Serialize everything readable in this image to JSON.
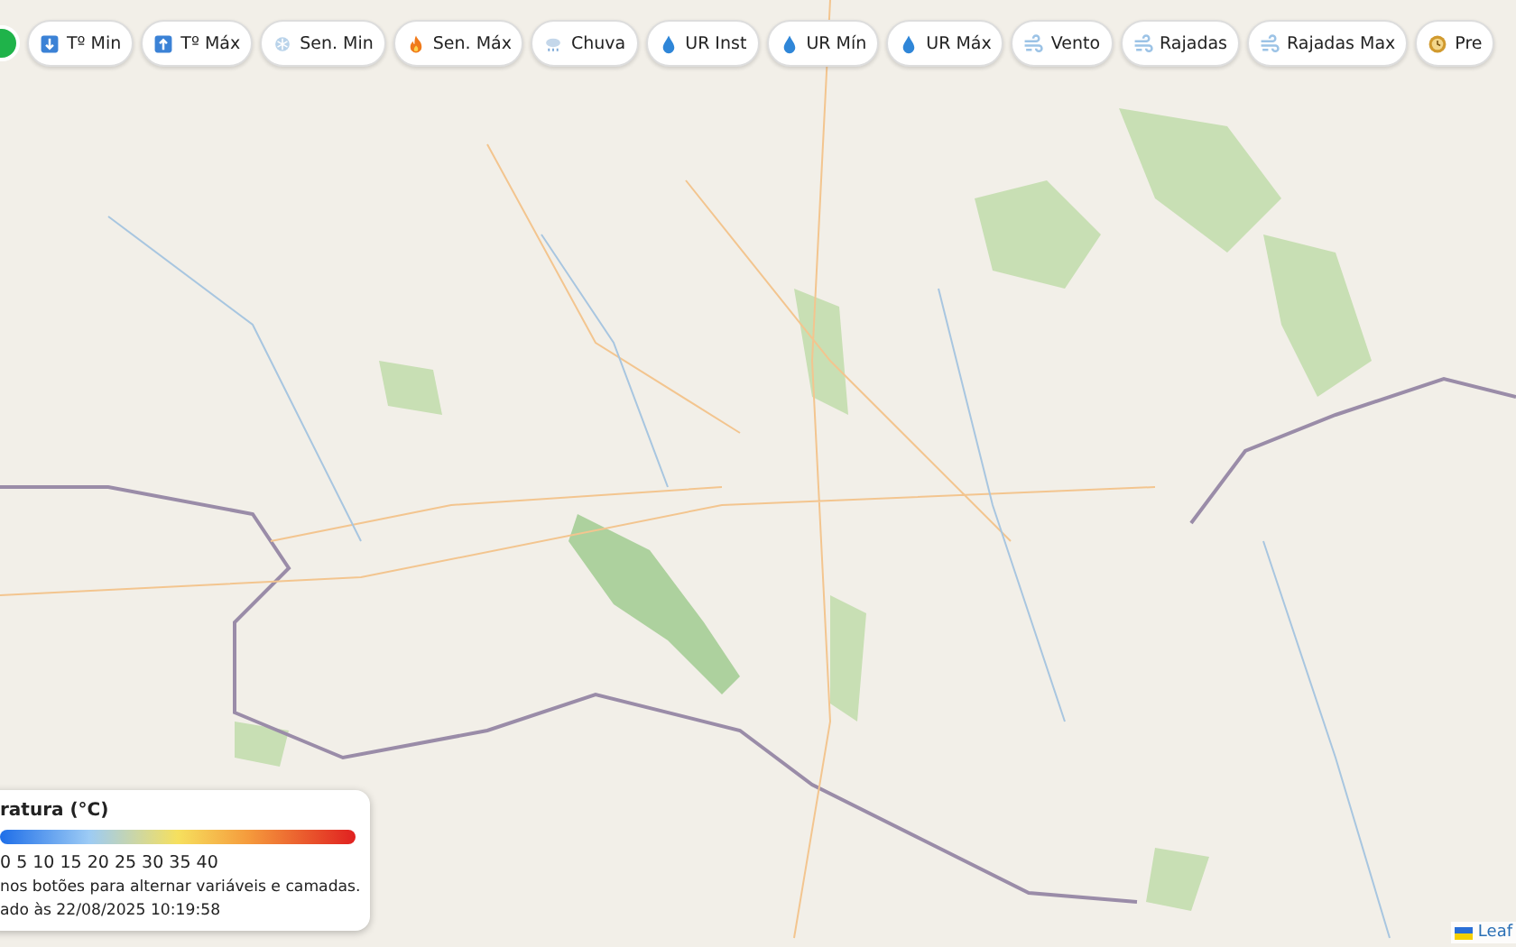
{
  "toolbar": {
    "buttons": [
      {
        "label": "Tº Min",
        "kind": "down"
      },
      {
        "label": "Tº Máx",
        "kind": "up"
      },
      {
        "label": "Sen. Min",
        "kind": "snow"
      },
      {
        "label": "Sen. Máx",
        "kind": "fire"
      },
      {
        "label": "Chuva",
        "kind": "rain"
      },
      {
        "label": "UR Inst",
        "kind": "drop"
      },
      {
        "label": "UR Mín",
        "kind": "drop"
      },
      {
        "label": "UR Máx",
        "kind": "drop"
      },
      {
        "label": "Vento",
        "kind": "wind"
      },
      {
        "label": "Rajadas",
        "kind": "wind"
      },
      {
        "label": "Rajadas Max",
        "kind": "wind"
      },
      {
        "label": "Pre",
        "kind": "clock"
      }
    ]
  },
  "legend": {
    "title": "ratura (°C)",
    "scale": "0 5 10 15 20 25 30 35 40",
    "hint": "nos botões para alternar variáveis e camadas.",
    "updated": "ado às 22/08/2025 10:19:58"
  },
  "attribution": "Leaf"
}
